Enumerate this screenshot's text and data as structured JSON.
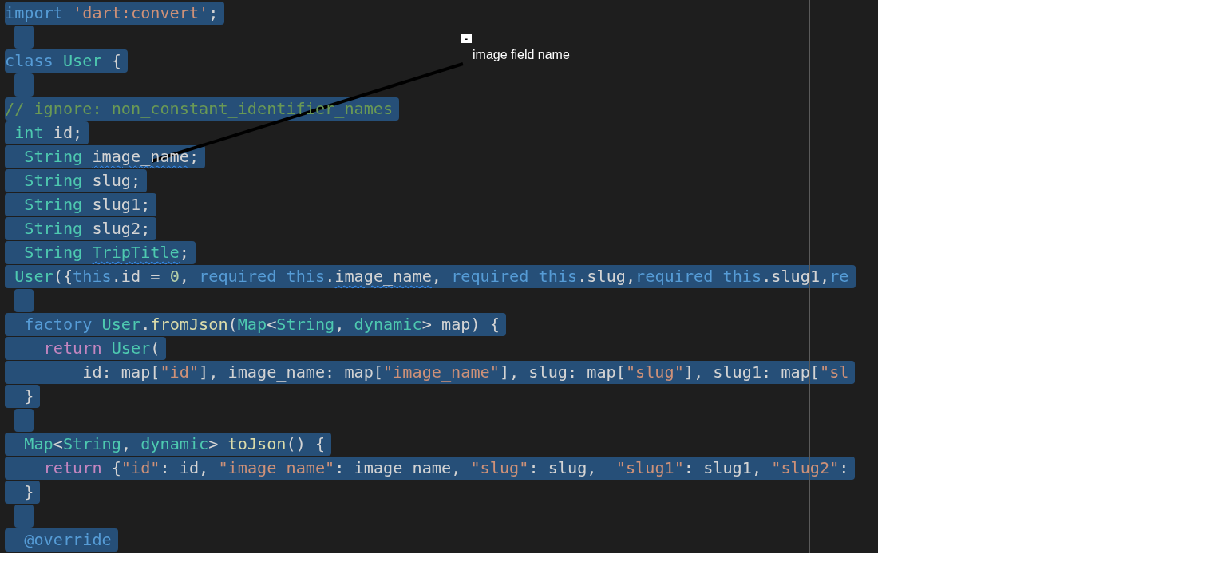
{
  "editor": {
    "lines": [
      {
        "selected": true,
        "tokens": [
          {
            "kind": "kw",
            "text": "import "
          },
          {
            "kind": "str",
            "text": "'dart:convert'"
          },
          {
            "kind": "plain",
            "text": ";"
          }
        ]
      },
      {
        "selected": true
      },
      {
        "selected": true,
        "tokens": [
          {
            "kind": "kw",
            "text": "class "
          },
          {
            "kind": "type",
            "text": "User"
          },
          {
            "kind": "plain",
            "text": " {"
          }
        ]
      },
      {
        "selected": true
      },
      {
        "selected": true,
        "tokens": [
          {
            "kind": "comment",
            "text": "// ignore: non_constant_identifier_names"
          }
        ]
      },
      {
        "selected": true,
        "tokens": [
          {
            "kind": "type",
            "text": " int"
          },
          {
            "kind": "plain",
            "text": " id;"
          }
        ]
      },
      {
        "selected": true,
        "tokens": [
          {
            "kind": "type",
            "text": "  String "
          },
          {
            "kind": "plain",
            "text": "image_name",
            "warning": true
          },
          {
            "kind": "plain",
            "text": ";"
          }
        ]
      },
      {
        "selected": true,
        "tokens": [
          {
            "kind": "type",
            "text": "  String"
          },
          {
            "kind": "plain",
            "text": " slug;"
          }
        ]
      },
      {
        "selected": true,
        "tokens": [
          {
            "kind": "type",
            "text": "  String"
          },
          {
            "kind": "plain",
            "text": " slug1;"
          }
        ]
      },
      {
        "selected": true,
        "tokens": [
          {
            "kind": "type",
            "text": "  String"
          },
          {
            "kind": "plain",
            "text": " slug2;"
          }
        ]
      },
      {
        "selected": true,
        "tokens": [
          {
            "kind": "type",
            "text": "  String "
          },
          {
            "kind": "type",
            "text": "TripTitle",
            "warning": true
          },
          {
            "kind": "plain",
            "text": ";"
          }
        ]
      },
      {
        "selected": true,
        "tokens": [
          {
            "kind": "type",
            "text": " User"
          },
          {
            "kind": "plain",
            "text": "({"
          },
          {
            "kind": "kw",
            "text": "this"
          },
          {
            "kind": "plain",
            "text": ".id = "
          },
          {
            "kind": "num",
            "text": "0"
          },
          {
            "kind": "plain",
            "text": ", "
          },
          {
            "kind": "kw",
            "text": "required this"
          },
          {
            "kind": "plain",
            "text": "."
          },
          {
            "kind": "plain",
            "text": "image_name",
            "warning": true
          },
          {
            "kind": "plain",
            "text": ", "
          },
          {
            "kind": "kw",
            "text": "required this"
          },
          {
            "kind": "plain",
            "text": ".slug,"
          },
          {
            "kind": "kw",
            "text": "required this"
          },
          {
            "kind": "plain",
            "text": ".slug1,"
          },
          {
            "kind": "kw",
            "text": "re"
          }
        ]
      },
      {
        "selected": true
      },
      {
        "selected": true,
        "tokens": [
          {
            "kind": "kw",
            "text": "  factory "
          },
          {
            "kind": "type",
            "text": "User"
          },
          {
            "kind": "plain",
            "text": "."
          },
          {
            "kind": "func",
            "text": "fromJson"
          },
          {
            "kind": "plain",
            "text": "("
          },
          {
            "kind": "type",
            "text": "Map"
          },
          {
            "kind": "plain",
            "text": "<"
          },
          {
            "kind": "type",
            "text": "String"
          },
          {
            "kind": "plain",
            "text": ", "
          },
          {
            "kind": "type",
            "text": "dynamic"
          },
          {
            "kind": "plain",
            "text": "> map) {"
          }
        ]
      },
      {
        "selected": true,
        "tokens": [
          {
            "kind": "control",
            "text": "    return "
          },
          {
            "kind": "type",
            "text": "User"
          },
          {
            "kind": "plain",
            "text": "("
          }
        ]
      },
      {
        "selected": true,
        "tokens": [
          {
            "kind": "plain",
            "text": "        id: map["
          },
          {
            "kind": "str",
            "text": "\"id\""
          },
          {
            "kind": "plain",
            "text": "], image_name: map["
          },
          {
            "kind": "str",
            "text": "\"image_name\""
          },
          {
            "kind": "plain",
            "text": "], slug: map["
          },
          {
            "kind": "str",
            "text": "\"slug\""
          },
          {
            "kind": "plain",
            "text": "], slug1: map["
          },
          {
            "kind": "str",
            "text": "\"sl"
          }
        ]
      },
      {
        "selected": true,
        "tokens": [
          {
            "kind": "plain",
            "text": "  }"
          }
        ]
      },
      {
        "selected": true
      },
      {
        "selected": true,
        "tokens": [
          {
            "kind": "type",
            "text": "  Map"
          },
          {
            "kind": "plain",
            "text": "<"
          },
          {
            "kind": "type",
            "text": "String"
          },
          {
            "kind": "plain",
            "text": ", "
          },
          {
            "kind": "type",
            "text": "dynamic"
          },
          {
            "kind": "plain",
            "text": "> "
          },
          {
            "kind": "func",
            "text": "toJson"
          },
          {
            "kind": "plain",
            "text": "() {"
          }
        ]
      },
      {
        "selected": true,
        "tokens": [
          {
            "kind": "control",
            "text": "    return"
          },
          {
            "kind": "plain",
            "text": " {"
          },
          {
            "kind": "str",
            "text": "\"id\""
          },
          {
            "kind": "plain",
            "text": ": id, "
          },
          {
            "kind": "str",
            "text": "\"image_name\""
          },
          {
            "kind": "plain",
            "text": ": image_name, "
          },
          {
            "kind": "str",
            "text": "\"slug\""
          },
          {
            "kind": "plain",
            "text": ": slug,  "
          },
          {
            "kind": "str",
            "text": "\"slug1\""
          },
          {
            "kind": "plain",
            "text": ": slug1, "
          },
          {
            "kind": "str",
            "text": "\"slug2\""
          },
          {
            "kind": "plain",
            "text": ":"
          }
        ]
      },
      {
        "selected": true,
        "tokens": [
          {
            "kind": "plain",
            "text": "  }"
          }
        ]
      },
      {
        "selected": true
      },
      {
        "selected": true,
        "tokens": [
          {
            "kind": "kw",
            "text": "  @override"
          }
        ]
      }
    ]
  },
  "annotation": {
    "collapse_button": "-",
    "label": "image field name"
  }
}
